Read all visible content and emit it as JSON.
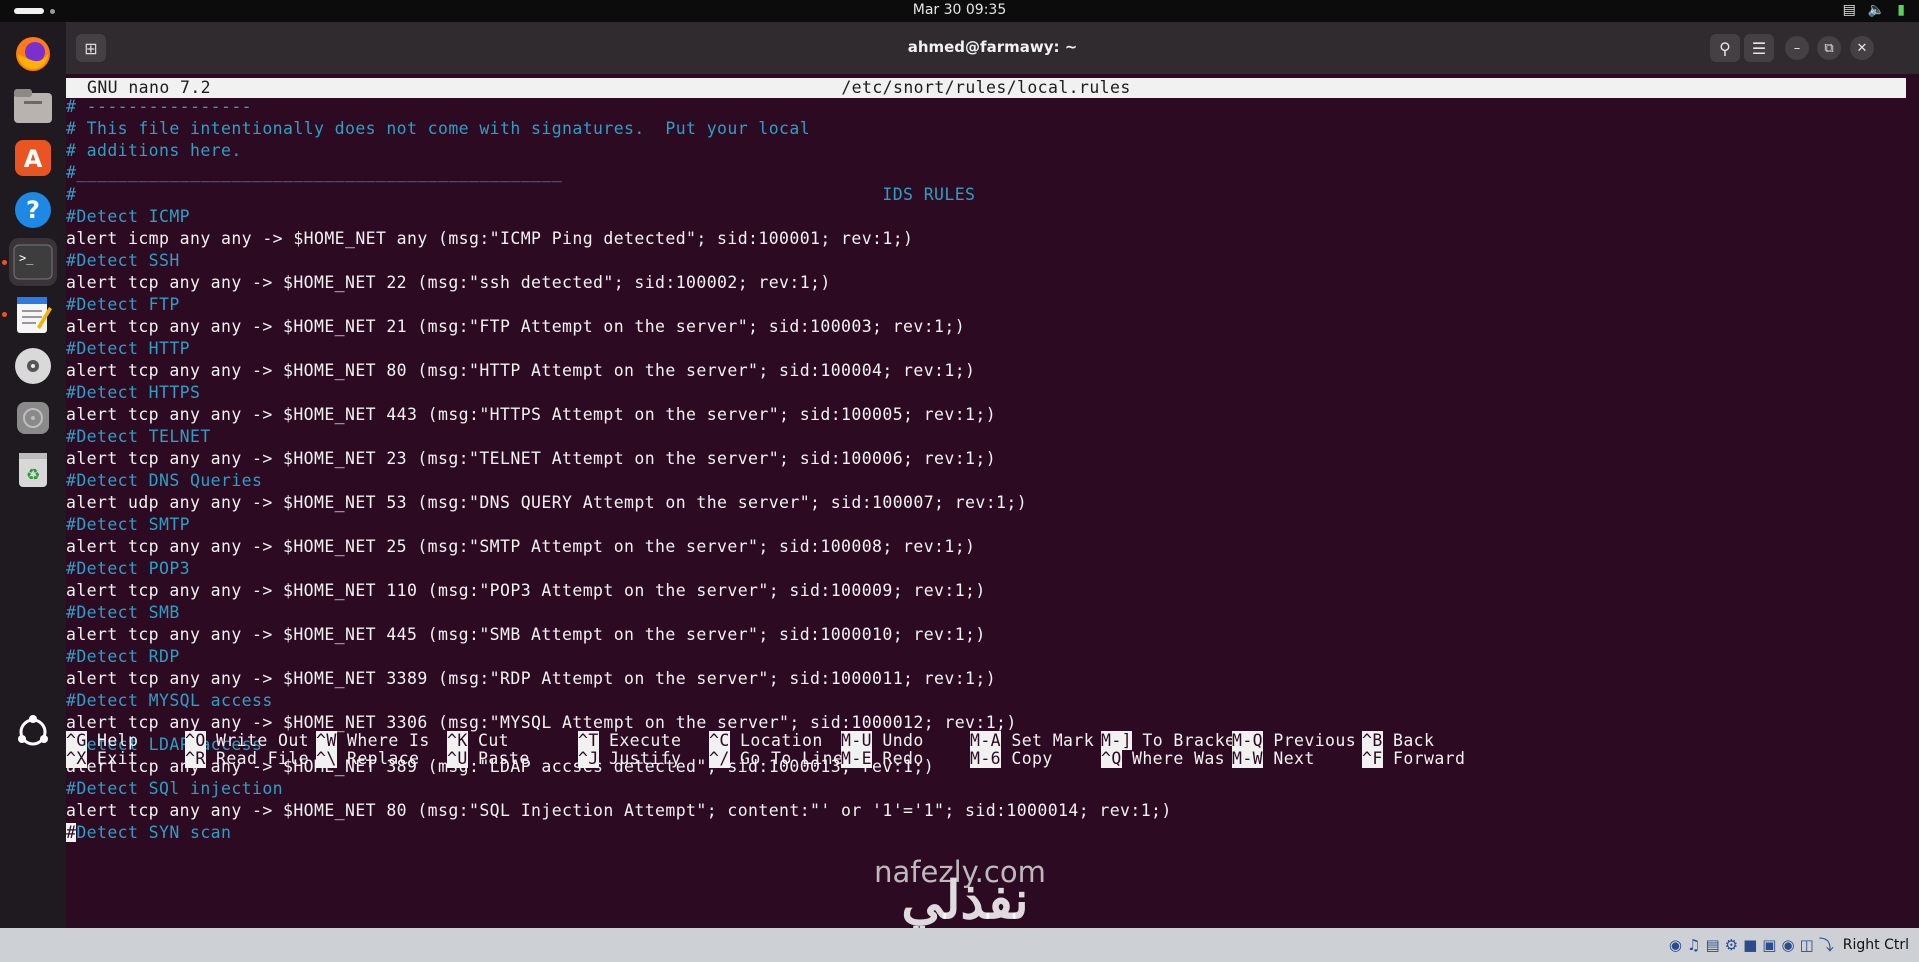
{
  "topbar": {
    "clock": "Mar 30  09:35",
    "tray_icons": [
      "network-icon",
      "volume-icon",
      "battery-icon"
    ]
  },
  "dock": {
    "apps": [
      {
        "name": "firefox",
        "icon": "firefox-icon"
      },
      {
        "name": "files",
        "icon": "files-icon"
      },
      {
        "name": "app-center",
        "icon": "app-center-icon"
      },
      {
        "name": "help",
        "icon": "help-icon"
      },
      {
        "name": "terminal",
        "icon": "terminal-icon",
        "active": true
      },
      {
        "name": "text-editor",
        "icon": "text-editor-icon"
      },
      {
        "name": "disc",
        "icon": "disc-icon"
      },
      {
        "name": "drive",
        "icon": "drive-icon"
      },
      {
        "name": "trash",
        "icon": "trash-icon"
      },
      {
        "name": "show-apps",
        "icon": "ubuntu-icon"
      }
    ]
  },
  "window": {
    "title": "ahmed@farmawy: ~"
  },
  "nano": {
    "version": "GNU nano 7.2",
    "filename": "/etc/snort/rules/local.rules",
    "lines": [
      {
        "text": "# ----------------",
        "type": "comment"
      },
      {
        "text": "# This file intentionally does not come with signatures.  Put your local",
        "type": "comment"
      },
      {
        "text": "# additions here.",
        "type": "comment"
      },
      {
        "text": "#_______________________________________________",
        "type": "comment"
      },
      {
        "text": "#                                                                              IDS RULES",
        "type": "comment"
      },
      {
        "text": "#Detect ICMP",
        "type": "comment"
      },
      {
        "text": "alert icmp any any -> $HOME_NET any (msg:\"ICMP Ping detected\"; sid:100001; rev:1;)",
        "type": "rule"
      },
      {
        "text": "#Detect SSH",
        "type": "comment"
      },
      {
        "text": "alert tcp any any -> $HOME_NET 22 (msg:\"ssh detected\"; sid:100002; rev:1;)",
        "type": "rule"
      },
      {
        "text": "#Detect FTP",
        "type": "comment"
      },
      {
        "text": "alert tcp any any -> $HOME_NET 21 (msg:\"FTP Attempt on the server\"; sid:100003; rev:1;)",
        "type": "rule"
      },
      {
        "text": "#Detect HTTP",
        "type": "comment"
      },
      {
        "text": "alert tcp any any -> $HOME_NET 80 (msg:\"HTTP Attempt on the server\"; sid:100004; rev:1;)",
        "type": "rule"
      },
      {
        "text": "#Detect HTTPS",
        "type": "comment"
      },
      {
        "text": "alert tcp any any -> $HOME_NET 443 (msg:\"HTTPS Attempt on the server\"; sid:100005; rev:1;)",
        "type": "rule"
      },
      {
        "text": "#Detect TELNET",
        "type": "comment"
      },
      {
        "text": "alert tcp any any -> $HOME_NET 23 (msg:\"TELNET Attempt on the server\"; sid:100006; rev:1;)",
        "type": "rule"
      },
      {
        "text": "#Detect DNS Queries",
        "type": "comment"
      },
      {
        "text": "alert udp any any -> $HOME_NET 53 (msg:\"DNS QUERY Attempt on the server\"; sid:100007; rev:1;)",
        "type": "rule"
      },
      {
        "text": "#Detect SMTP",
        "type": "comment"
      },
      {
        "text": "alert tcp any any -> $HOME_NET 25 (msg:\"SMTP Attempt on the server\"; sid:100008; rev:1;)",
        "type": "rule"
      },
      {
        "text": "#Detect POP3",
        "type": "comment"
      },
      {
        "text": "alert tcp any any -> $HOME_NET 110 (msg:\"POP3 Attempt on the server\"; sid:100009; rev:1;)",
        "type": "rule"
      },
      {
        "text": "#Detect SMB",
        "type": "comment"
      },
      {
        "text": "alert tcp any any -> $HOME_NET 445 (msg:\"SMB Attempt on the server\"; sid:1000010; rev:1;)",
        "type": "rule"
      },
      {
        "text": "#Detect RDP",
        "type": "comment"
      },
      {
        "text": "alert tcp any any -> $HOME_NET 3389 (msg:\"RDP Attempt on the server\"; sid:1000011; rev:1;)",
        "type": "rule"
      },
      {
        "text": "#Detect MYSQL access",
        "type": "comment"
      },
      {
        "text": "alert tcp any any -> $HOME_NET 3306 (msg:\"MYSQL Attempt on the server\"; sid:1000012; rev:1;)",
        "type": "rule"
      },
      {
        "text": "#Detect LDAP access",
        "type": "comment"
      },
      {
        "text": "alert tcp any any -> $HOME_NET 389 (msg:\"LDAP accses detected\"; sid:1000013; rev:1;)",
        "type": "rule"
      },
      {
        "text": "#Detect SQl injection",
        "type": "comment"
      },
      {
        "text": "alert tcp any any -> $HOME_NET 80 (msg:\"SQL Injection Attempt\"; content:\"' or '1'='1\"; sid:1000014; rev:1;)",
        "type": "rule"
      },
      {
        "text": "#Detect SYN scan",
        "type": "comment",
        "cursor": true
      }
    ],
    "shortcuts": [
      {
        "key": "^G",
        "label": "Help"
      },
      {
        "key": "^X",
        "label": "Exit"
      },
      {
        "key": "^O",
        "label": "Write Out"
      },
      {
        "key": "^R",
        "label": "Read File"
      },
      {
        "key": "^W",
        "label": "Where Is"
      },
      {
        "key": "^\\",
        "label": "Replace"
      },
      {
        "key": "^K",
        "label": "Cut"
      },
      {
        "key": "^U",
        "label": "Paste"
      },
      {
        "key": "^T",
        "label": "Execute"
      },
      {
        "key": "^J",
        "label": "Justify"
      },
      {
        "key": "^C",
        "label": "Location"
      },
      {
        "key": "^/",
        "label": "Go To Line"
      },
      {
        "key": "M-U",
        "label": "Undo"
      },
      {
        "key": "M-E",
        "label": "Redo"
      },
      {
        "key": "M-A",
        "label": "Set Mark"
      },
      {
        "key": "M-6",
        "label": "Copy"
      },
      {
        "key": "M-]",
        "label": "To Bracket"
      },
      {
        "key": "^Q",
        "label": "Where Was"
      },
      {
        "key": "M-Q",
        "label": "Previous"
      },
      {
        "key": "M-W",
        "label": "Next"
      },
      {
        "key": "^B",
        "label": "Back"
      },
      {
        "key": "^F",
        "label": "Forward"
      }
    ]
  },
  "watermark": {
    "logo_text": "نفذلي",
    "text": "nafezly.com"
  },
  "vm_status": {
    "host_key": "Right Ctrl"
  },
  "colors": {
    "comment": "#2c9fc4",
    "rule": "#f2f2f2",
    "background": "#2c0a22"
  }
}
